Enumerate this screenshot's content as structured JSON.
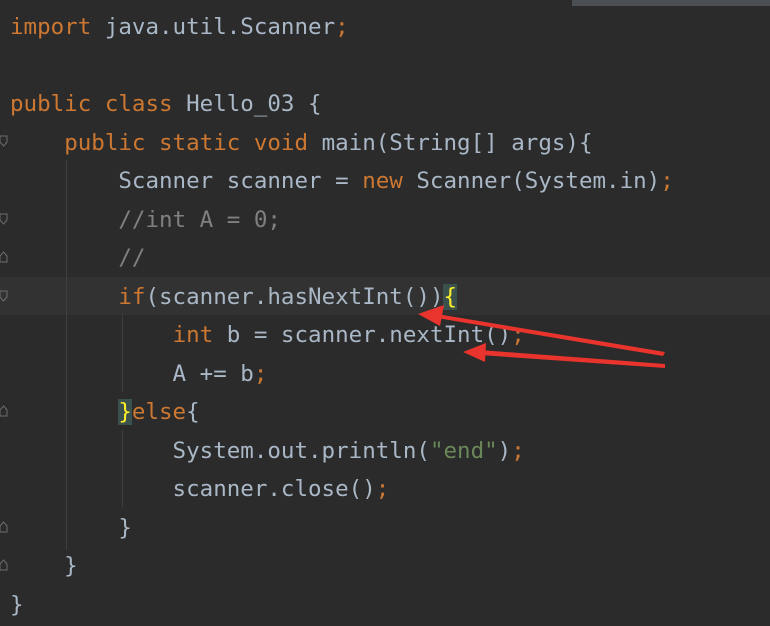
{
  "editor": {
    "lines": [
      [
        [
          "kw",
          "import"
        ],
        [
          "txt",
          " java.util.Scanner"
        ],
        [
          "kw",
          ";"
        ]
      ],
      [],
      [
        [
          "kw",
          "public class "
        ],
        [
          "txt",
          "Hello_03 {"
        ]
      ],
      [
        [
          "txt",
          "    "
        ],
        [
          "kw",
          "public static void "
        ],
        [
          "txt",
          "main(String[] args){"
        ]
      ],
      [
        [
          "txt",
          "        Scanner scanner = "
        ],
        [
          "kw",
          "new "
        ],
        [
          "txt",
          "Scanner(System.in)"
        ],
        [
          "kw",
          ";"
        ]
      ],
      [
        [
          "txt",
          "        "
        ],
        [
          "cmt",
          "//int A = 0;"
        ]
      ],
      [
        [
          "txt",
          "        "
        ],
        [
          "cmt",
          "//"
        ]
      ],
      [
        [
          "txt",
          "        "
        ],
        [
          "kw",
          "if"
        ],
        [
          "txt",
          "(scanner.hasNextInt())"
        ],
        [
          "brace",
          "{"
        ]
      ],
      [
        [
          "txt",
          "            "
        ],
        [
          "kw",
          "int "
        ],
        [
          "txt",
          "b = scanner.nextInt()"
        ],
        [
          "kw",
          ";"
        ]
      ],
      [
        [
          "txt",
          "            A += b"
        ],
        [
          "kw",
          ";"
        ]
      ],
      [
        [
          "txt",
          "        "
        ],
        [
          "brace",
          "}"
        ],
        [
          "kw",
          "else"
        ],
        [
          "txt",
          "{"
        ]
      ],
      [
        [
          "txt",
          "            System.out.println("
        ],
        [
          "str",
          "\"end\""
        ],
        [
          "txt",
          ")"
        ],
        [
          "kw",
          ";"
        ]
      ],
      [
        [
          "txt",
          "            scanner.close()"
        ],
        [
          "kw",
          ";"
        ]
      ],
      [
        [
          "txt",
          "        }"
        ]
      ],
      [
        [
          "txt",
          "    }"
        ]
      ],
      [
        [
          "txt",
          "}"
        ]
      ]
    ]
  },
  "colors": {
    "background": "#2b2b2b",
    "keyword": "#cc7832",
    "text": "#a9b7c6",
    "string": "#6a8759",
    "comment": "#808080",
    "annotation_arrow": "#e8342c"
  }
}
